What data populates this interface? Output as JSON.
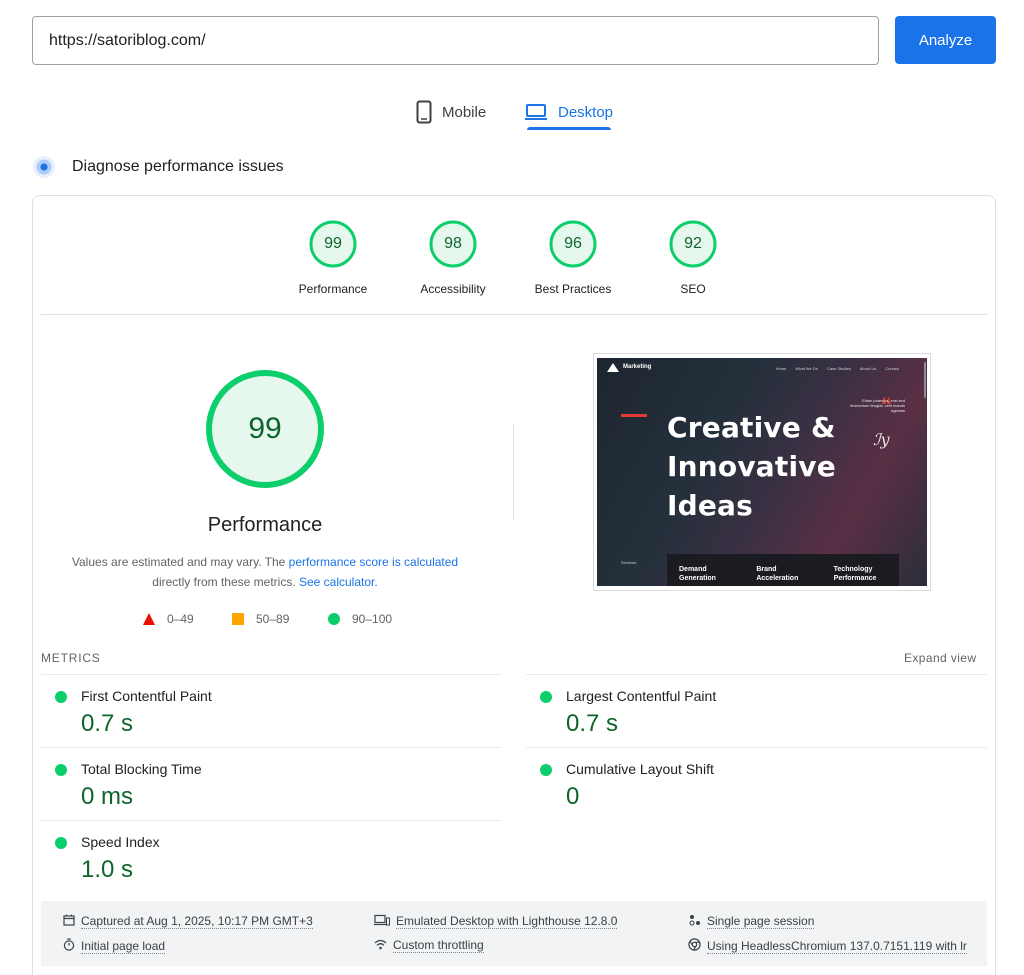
{
  "search": {
    "url": "https://satoriblog.com/",
    "analyze_label": "Analyze"
  },
  "tabs": [
    {
      "label": "Mobile",
      "active": false,
      "icon": "phone-icon"
    },
    {
      "label": "Desktop",
      "active": true,
      "icon": "laptop-icon"
    }
  ],
  "diagnose": {
    "title": "Diagnose performance issues"
  },
  "gauges": [
    {
      "score": "99",
      "label": "Performance"
    },
    {
      "score": "98",
      "label": "Accessibility"
    },
    {
      "score": "96",
      "label": "Best Practices"
    },
    {
      "score": "92",
      "label": "SEO"
    }
  ],
  "performance": {
    "score": "99",
    "title": "Performance",
    "desc_prefix": "Values are estimated and may vary. The ",
    "desc_link1": "performance score is calculated",
    "desc_mid": "directly from these metrics. ",
    "desc_link2": "See calculator.",
    "legend": [
      "0–49",
      "50–89",
      "90–100"
    ]
  },
  "thumbnail": {
    "brand": "Marketing",
    "nav": [
      "Home",
      "What We Do",
      "Case Studies",
      "About Us",
      "Contact"
    ],
    "hero_lines": [
      "Creative &",
      "Innovative",
      "Ideas"
    ],
    "quote": "Etiam pharetra, erat sed fermentum feugiat, velit mauris egestas",
    "services": "Services",
    "bottom_cells": [
      [
        "Demand",
        "Generation"
      ],
      [
        "Brand",
        "Acceleration"
      ],
      [
        "Technology",
        "Performance"
      ]
    ]
  },
  "metrics": {
    "title": "METRICS",
    "expand": "Expand view",
    "items": [
      {
        "label": "First Contentful Paint",
        "value": "0.7 s"
      },
      {
        "label": "Largest Contentful Paint",
        "value": "0.7 s"
      },
      {
        "label": "Total Blocking Time",
        "value": "0 ms"
      },
      {
        "label": "Cumulative Layout Shift",
        "value": "0"
      },
      {
        "label": "Speed Index",
        "value": "1.0 s"
      }
    ]
  },
  "runtime": {
    "captured": "Captured at Aug 1, 2025, 10:17 PM GMT+3",
    "page_load": "Initial page load",
    "emulated": "Emulated Desktop with Lighthouse 12.8.0",
    "throttling": "Custom throttling",
    "session": "Single page session",
    "browser": "Using HeadlessChromium 137.0.7151.119 with lr"
  },
  "colors": {
    "accent": "#1a73e8",
    "pass": "#0cce6b",
    "pass_text": "#0d652d",
    "average": "#ffa400",
    "fail": "#eb0f00"
  }
}
